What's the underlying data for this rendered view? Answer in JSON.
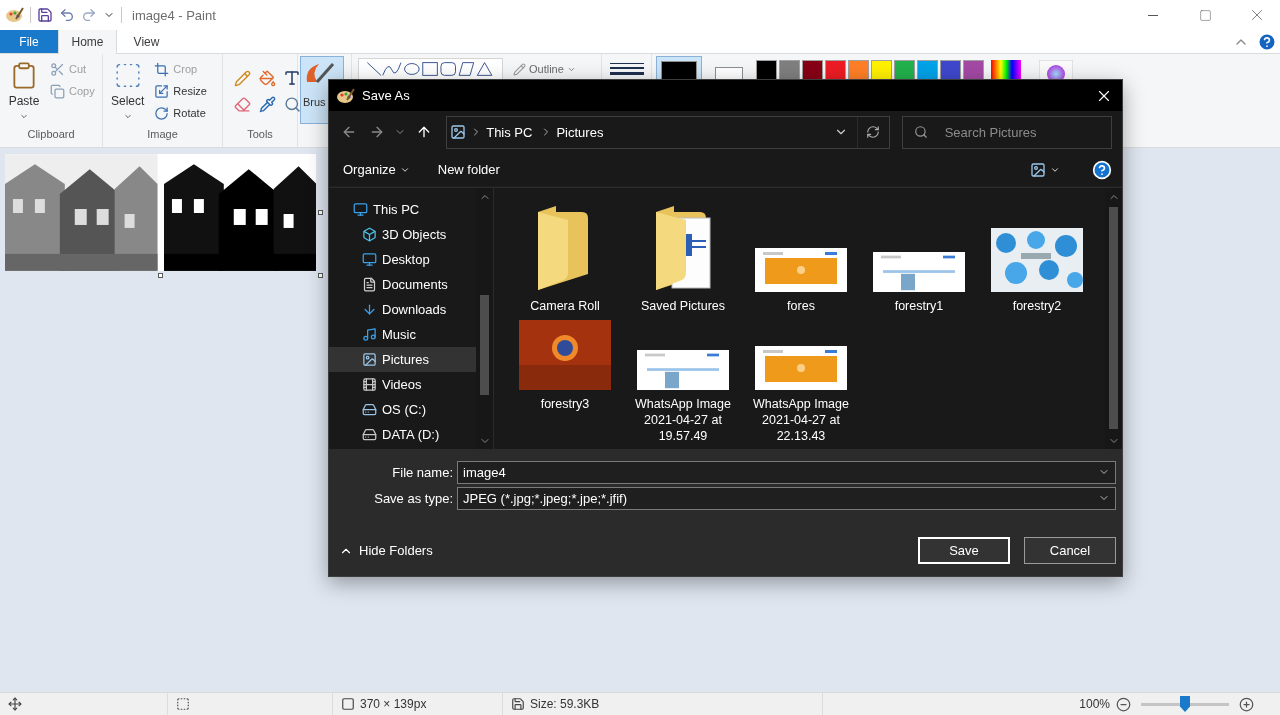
{
  "app": {
    "title": "image4 - Paint"
  },
  "ribbon_tabs": [
    {
      "label": "File",
      "kind": "file",
      "selected": false
    },
    {
      "label": "Home",
      "kind": "tab",
      "selected": true
    },
    {
      "label": "View",
      "kind": "tab",
      "selected": false
    }
  ],
  "ribbon": {
    "clipboard": {
      "label": "Clipboard",
      "paste": "Paste",
      "small": [
        {
          "label": "Cut",
          "disabled": true
        },
        {
          "label": "Copy",
          "disabled": true
        }
      ]
    },
    "image": {
      "label": "Image",
      "select": "Select",
      "small": [
        {
          "label": "Crop",
          "disabled": true
        },
        {
          "label": "Resize",
          "disabled": false
        },
        {
          "label": "Rotate",
          "disabled": false
        }
      ]
    },
    "tools": {
      "label": "Tools"
    },
    "brushes": {
      "label": "Brus",
      "selected": true
    },
    "outline": "Outline",
    "color_slots": [
      {
        "color": "#000000",
        "selected": true
      },
      {
        "color": "#ffffff",
        "selected": false
      }
    ],
    "palette": [
      {
        "color": "#000000"
      },
      {
        "color": "#7f7f7f"
      },
      {
        "color": "#880015"
      },
      {
        "color": "#ed1c24"
      },
      {
        "color": "#ff7f27"
      },
      {
        "color": "#fff200"
      },
      {
        "color": "#22b14c"
      },
      {
        "color": "#00a2e8"
      },
      {
        "color": "#3f48cc"
      },
      {
        "color": "#a349a4"
      }
    ]
  },
  "status_bar": {
    "dimensions": "370 × 139px",
    "size": "Size: 59.3KB",
    "zoom": "100%",
    "zoom_level": {
      "level": 0.5
    }
  },
  "dialog": {
    "title": "Save As",
    "breadcrumb": [
      "This PC",
      "Pictures"
    ],
    "search_placeholder": "Search Pictures",
    "organize": "Organize",
    "new_folder": "New folder",
    "nav": [
      {
        "label": "This PC",
        "selected": false,
        "children": [
          {
            "label": "3D Objects",
            "selected": false
          },
          {
            "label": "Desktop",
            "selected": false
          },
          {
            "label": "Documents",
            "selected": false
          },
          {
            "label": "Downloads",
            "selected": false
          },
          {
            "label": "Music",
            "selected": false
          },
          {
            "label": "Pictures",
            "selected": true
          },
          {
            "label": "Videos",
            "selected": false
          },
          {
            "label": "OS (C:)",
            "selected": false
          },
          {
            "label": "DATA (D:)",
            "selected": false
          }
        ]
      }
    ],
    "files": [
      {
        "name": "Camera Roll",
        "kind": "folder"
      },
      {
        "name": "Saved Pictures",
        "kind": "doc-folder"
      },
      {
        "name": "fores",
        "kind": "picture"
      },
      {
        "name": "forestry1",
        "kind": "picture"
      },
      {
        "name": "forestry2",
        "kind": "picture"
      },
      {
        "name": "forestry3",
        "kind": "picture"
      },
      {
        "name": "WhatsApp Image 2021-04-27 at 19.57.49",
        "kind": "picture"
      },
      {
        "name": "WhatsApp Image 2021-04-27 at 22.13.43",
        "kind": "picture"
      }
    ],
    "file_name": {
      "label": "File name:",
      "value": "image4"
    },
    "save_type": {
      "label": "Save as type:",
      "value": "JPEG (*.jpg;*.jpeg;*.jpe;*.jfif)"
    },
    "hide_folders": "Hide Folders",
    "buttons": [
      {
        "label": "Save",
        "kind": "primary"
      },
      {
        "label": "Cancel",
        "kind": "secondary"
      }
    ]
  }
}
